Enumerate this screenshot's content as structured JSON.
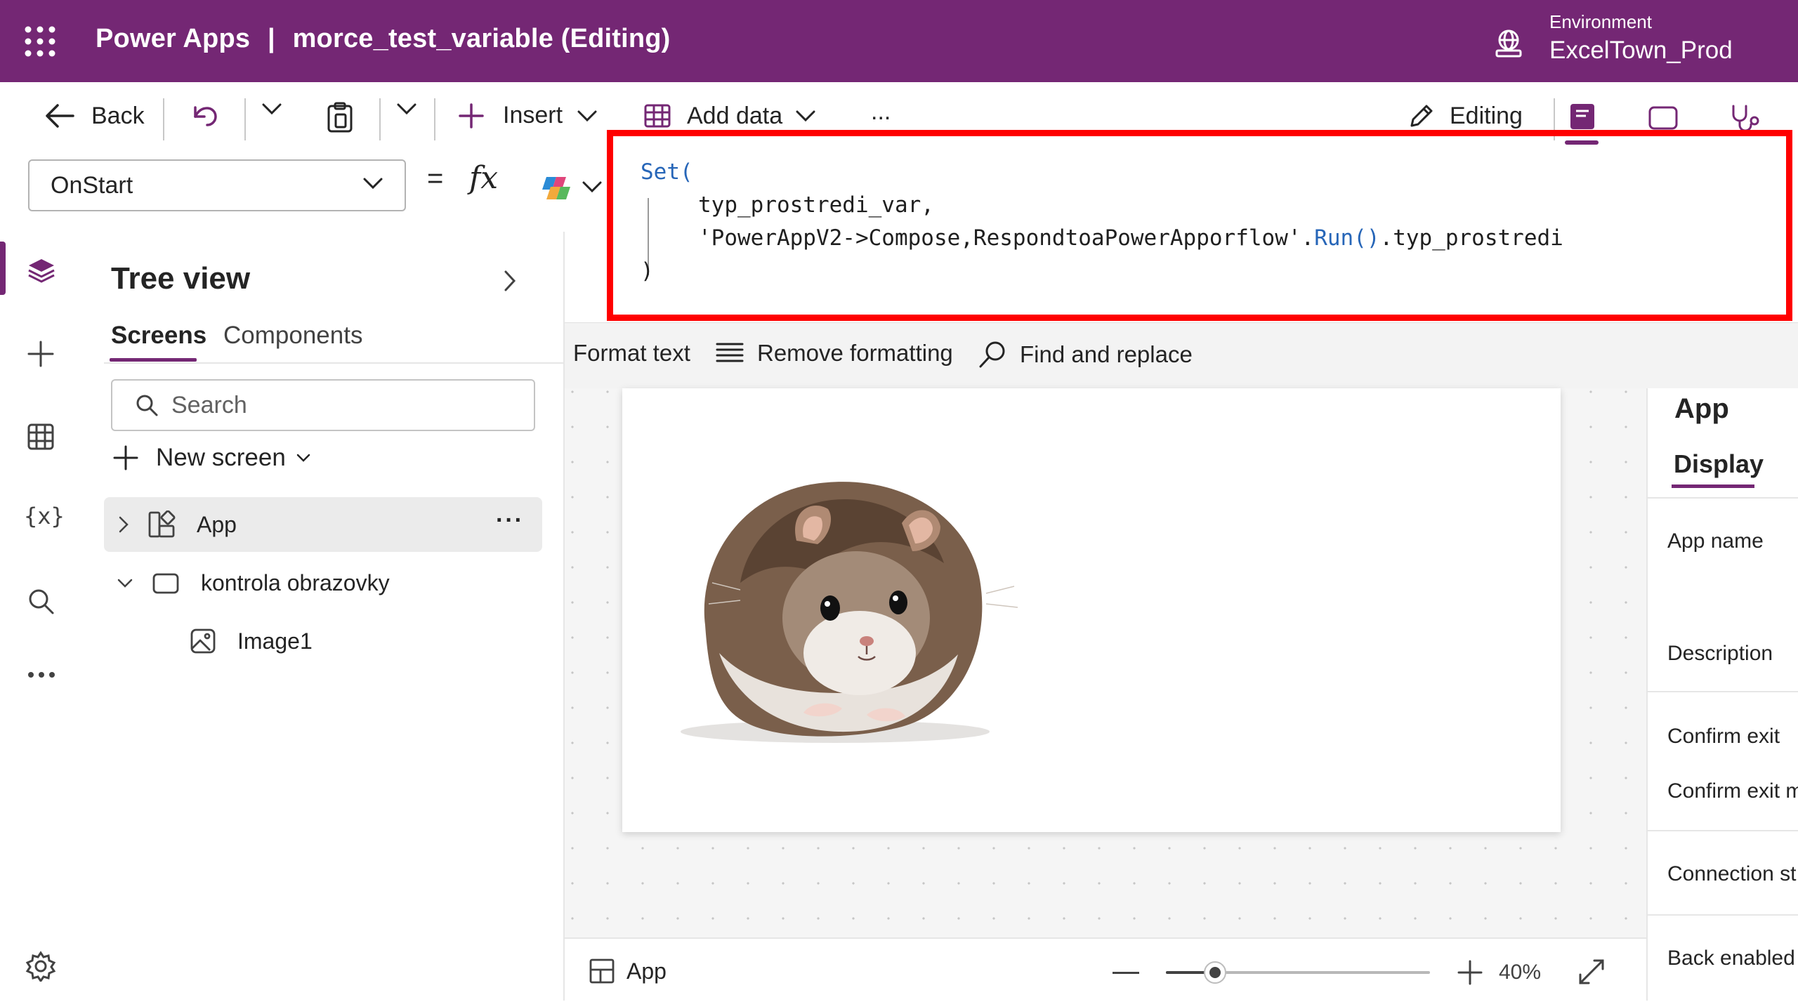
{
  "header": {
    "product": "Power Apps",
    "separator": "|",
    "app_title": "morce_test_variable (Editing)",
    "environment_label": "Environment",
    "environment_value": "ExcelTown_Prod"
  },
  "toolbar": {
    "back_label": "Back",
    "insert_label": "Insert",
    "add_data_label": "Add data",
    "more_label": "...",
    "editing_label": "Editing"
  },
  "formula_bar": {
    "property": "OnStart",
    "equals": "=",
    "fx": "fx",
    "code_line1_fn": "Set(",
    "code_line2": "typ_prostredi_var,",
    "code_line3_pre": "'PowerAppV2->Compose,RespondtoaPowerApporflow'.",
    "code_line3_fn": "Run()",
    "code_line3_post": ".typ_prostredi",
    "code_line4": ")"
  },
  "format_toolbar": {
    "format_text": "Format text",
    "remove_formatting": "Remove formatting",
    "find_replace": "Find and replace"
  },
  "tree_view": {
    "title": "Tree view",
    "tabs": [
      "Screens",
      "Components"
    ],
    "active_tab": "Screens",
    "search_placeholder": "Search",
    "new_screen": "New screen",
    "items": [
      {
        "label": "App",
        "ellipsis": "···"
      },
      {
        "label": "kontrola obrazovky"
      },
      {
        "label": "Image1"
      }
    ]
  },
  "status_bar": {
    "screen_label": "App",
    "zoom_percent": 40,
    "zoom_text": "40%"
  },
  "properties_panel": {
    "title": "App",
    "tab": "Display",
    "fields": [
      "App name",
      "Description",
      "Confirm exit",
      "Confirm exit m",
      "Connection st",
      "Back enabled"
    ]
  },
  "colors": {
    "brand": "#742774",
    "highlight_box": "#ff0000",
    "keyword": "#2766b8"
  },
  "icons": [
    "app-launcher-icon",
    "environment-icon",
    "back-arrow-icon",
    "undo-icon",
    "paste-icon",
    "add-icon",
    "table-icon",
    "pencil-icon",
    "book-icon",
    "comment-icon",
    "stethoscope-icon",
    "copilot-icon",
    "layers-icon",
    "plus-icon",
    "grid-icon",
    "variables-icon",
    "search-icon",
    "more-icon",
    "settings-icon",
    "chevron-down-icon",
    "chevron-right-icon",
    "screen-icon",
    "image-icon",
    "expand-icon"
  ]
}
